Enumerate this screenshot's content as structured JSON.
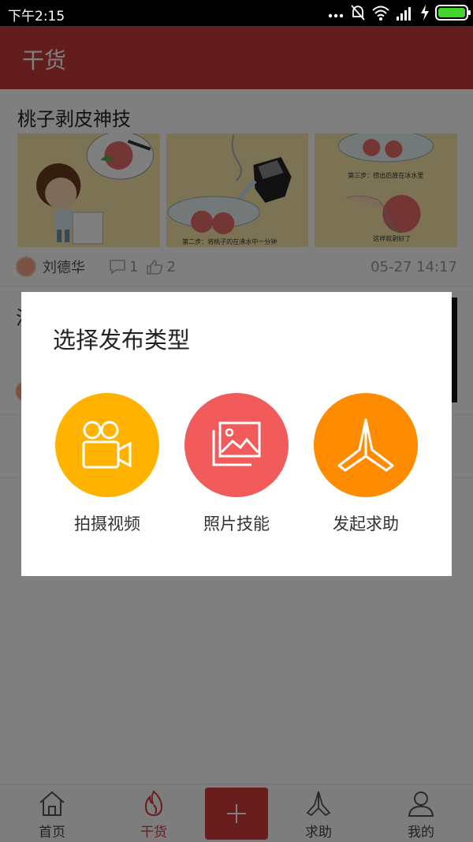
{
  "status_bar": {
    "time": "下午2:15",
    "icons": [
      "dots-icon",
      "mute-icon",
      "wifi-icon",
      "signal-icon",
      "charging-icon",
      "battery-icon"
    ],
    "battery_color": "#44d62c"
  },
  "app_bar": {
    "title": "干货",
    "color": "#c73a3a"
  },
  "feed": {
    "posts": [
      {
        "title": "桃子剥皮神技",
        "thumbnails": [
          "peach-cartoon-thumbnail",
          "kettle-pouring-thumbnail",
          "ice-water-thumbnail"
        ],
        "thumb_text": [
          "第二步：将桃子的在沸水中一分钟",
          "第三步：捞出后放在冰水里",
          "这样就剥好了"
        ],
        "author": "刘德华",
        "comments": "1",
        "likes": "2",
        "date": "05-27 14:17"
      },
      {
        "title_fragment": "注"
      }
    ]
  },
  "dialog": {
    "title": "选择发布类型",
    "options": [
      {
        "label": "拍摄视频",
        "icon": "video-camera-icon",
        "color": "#ffb300"
      },
      {
        "label": "照片技能",
        "icon": "photo-gallery-icon",
        "color": "#f25b5b"
      },
      {
        "label": "发起求助",
        "icon": "praying-hands-icon",
        "color": "#ff8c00"
      }
    ]
  },
  "bottom_nav": {
    "items": [
      {
        "label": "首页",
        "icon": "home-icon"
      },
      {
        "label": "干货",
        "icon": "flame-icon",
        "active": true
      },
      {
        "label": "",
        "icon": "plus-icon"
      },
      {
        "label": "求助",
        "icon": "praying-hands-icon"
      },
      {
        "label": "我的",
        "icon": "user-icon"
      }
    ],
    "active_color": "#d43a3a"
  }
}
